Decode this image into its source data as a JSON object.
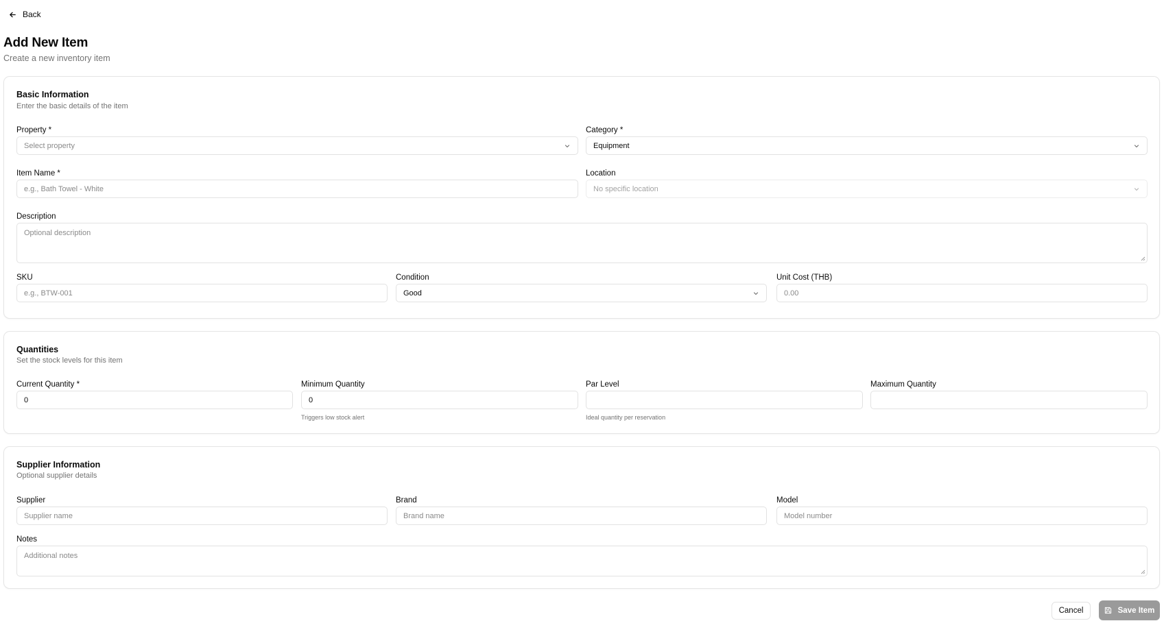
{
  "nav": {
    "back_label": "Back"
  },
  "header": {
    "title": "Add New Item",
    "subtitle": "Create a new inventory item"
  },
  "basic": {
    "title": "Basic Information",
    "description": "Enter the basic details of the item",
    "property": {
      "label": "Property *",
      "placeholder": "Select property"
    },
    "category": {
      "label": "Category *",
      "value": "Equipment"
    },
    "item_name": {
      "label": "Item Name *",
      "placeholder": "e.g., Bath Towel - White"
    },
    "location": {
      "label": "Location",
      "placeholder": "No specific location"
    },
    "description_field": {
      "label": "Description",
      "placeholder": "Optional description"
    },
    "sku": {
      "label": "SKU",
      "placeholder": "e.g., BTW-001"
    },
    "condition": {
      "label": "Condition",
      "value": "Good"
    },
    "unit_cost": {
      "label": "Unit Cost (THB)",
      "placeholder": "0.00"
    }
  },
  "quantities": {
    "title": "Quantities",
    "description": "Set the stock levels for this item",
    "current": {
      "label": "Current Quantity *",
      "value": "0"
    },
    "minimum": {
      "label": "Minimum Quantity",
      "value": "0",
      "hint": "Triggers low stock alert"
    },
    "par": {
      "label": "Par Level",
      "value": "",
      "hint": "Ideal quantity per reservation"
    },
    "maximum": {
      "label": "Maximum Quantity",
      "value": ""
    }
  },
  "supplier": {
    "title": "Supplier Information",
    "description": "Optional supplier details",
    "supplier": {
      "label": "Supplier",
      "placeholder": "Supplier name"
    },
    "brand": {
      "label": "Brand",
      "placeholder": "Brand name"
    },
    "model": {
      "label": "Model",
      "placeholder": "Model number"
    },
    "notes": {
      "label": "Notes",
      "placeholder": "Additional notes"
    }
  },
  "actions": {
    "cancel_label": "Cancel",
    "save_label": "Save Item"
  },
  "icons": {
    "back": "arrow-left-icon",
    "chevron": "chevron-down-icon",
    "save": "save-icon"
  },
  "colors": {
    "text": "#0a0a0a",
    "muted": "#737373",
    "border": "#e5e5e5",
    "save_button": "#9a9a9a"
  }
}
